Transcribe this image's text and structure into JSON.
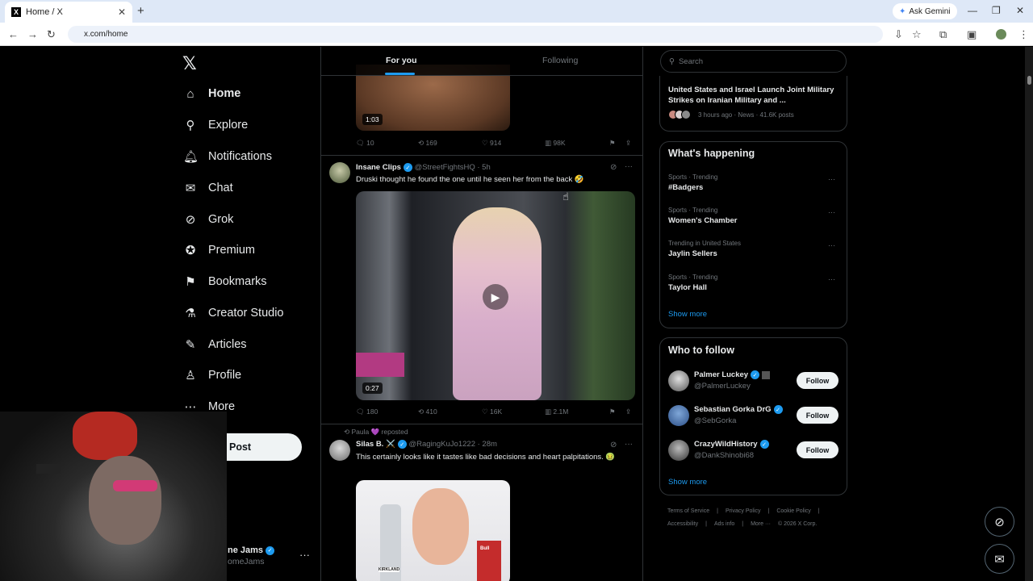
{
  "browser": {
    "tab_title": "Home / X",
    "tab_favicon": "X",
    "close_tab": "✕",
    "new_tab": "+",
    "gemini_label": "Ask Gemini",
    "url": "x.com/home"
  },
  "nav": {
    "logo": "𝕏",
    "items": [
      {
        "label": "Home",
        "icon": "⌂"
      },
      {
        "label": "Explore",
        "icon": "⚲"
      },
      {
        "label": "Notifications",
        "icon": "🔔︎"
      },
      {
        "label": "Chat",
        "icon": "✉"
      },
      {
        "label": "Grok",
        "icon": "⊘"
      },
      {
        "label": "Premium",
        "icon": "✪"
      },
      {
        "label": "Bookmarks",
        "icon": "⚑"
      },
      {
        "label": "Creator Studio",
        "icon": "⚗"
      },
      {
        "label": "Articles",
        "icon": "✎"
      },
      {
        "label": "Profile",
        "icon": "♙"
      },
      {
        "label": "More",
        "icon": "⋯"
      }
    ],
    "post_label": "Post",
    "account_name": "ne Jams",
    "account_handle": "omeJams"
  },
  "feed": {
    "tabs": [
      "For you",
      "Following"
    ],
    "post1": {
      "duration": "1:03",
      "replies": "10",
      "reposts": "169",
      "likes": "914",
      "views": "98K"
    },
    "post2": {
      "name": "Insane Clips",
      "handle": "@StreetFightsHQ",
      "time": "· 5h",
      "text": "Druski thought he found the one until he seen her from the back 🤣",
      "duration": "0:27",
      "replies": "180",
      "reposts": "410",
      "likes": "16K",
      "views": "2.1M"
    },
    "post3": {
      "repost_by": "Paula 💜 reposted",
      "name": "Silas B. ⚔️",
      "handle": "@RagingKuJo1222",
      "time": "· 28m",
      "text": "This certainly looks like it tastes like bad decisions and heart palpitations. 🤢",
      "brand1": "KIRKLAND",
      "brand2": "Bull"
    }
  },
  "sidebar": {
    "search_placeholder": "Search",
    "news": {
      "title": "United States and Israel Launch Joint Military Strikes on Iranian Military and ...",
      "meta": "3 hours ago · News · 41.6K posts"
    },
    "happening_title": "What's happening",
    "trends": [
      {
        "meta": "Sports · Trending",
        "name": "#Badgers"
      },
      {
        "meta": "Sports · Trending",
        "name": "Women's Chamber"
      },
      {
        "meta": "Trending in United States",
        "name": "Jaylin Sellers"
      },
      {
        "meta": "Sports · Trending",
        "name": "Taylor Hall"
      }
    ],
    "show_more": "Show more",
    "wtf_title": "Who to follow",
    "wtf": [
      {
        "name": "Palmer Luckey",
        "handle": "@PalmerLuckey"
      },
      {
        "name": "Sebastian Gorka DrG",
        "handle": "@SebGorka"
      },
      {
        "name": "CrazyWildHistory",
        "handle": "@DankShinobi68"
      }
    ],
    "follow_label": "Follow",
    "footer": [
      "Terms of Service",
      "|",
      "Privacy Policy",
      "|",
      "Cookie Policy",
      "|",
      "Accessibility",
      "|",
      "Ads info",
      "|",
      "More ···",
      "© 2026 X Corp."
    ]
  },
  "colors": {
    "accent": "#1d9bf0",
    "bg": "#000000",
    "border": "#2f3336"
  }
}
